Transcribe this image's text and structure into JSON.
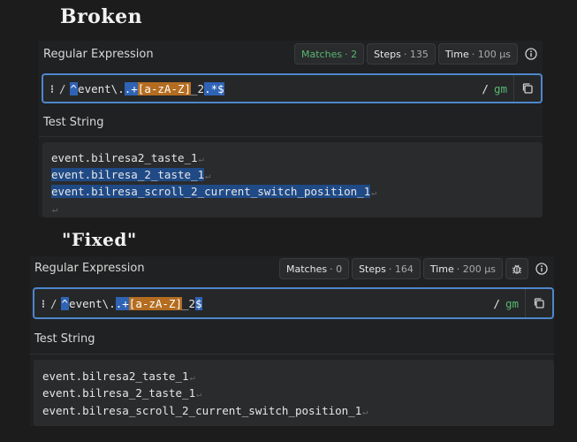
{
  "broken": {
    "heading": "Broken",
    "section_title": "Regular Expression",
    "stats": {
      "matches": "Matches",
      "matches_val": "· 2",
      "steps": "Steps",
      "steps_val": "· 135",
      "time": "Time",
      "time_val": "· 100 µs"
    },
    "regex": {
      "drag": "⁝",
      "open_slash": "/",
      "anchor": "^",
      "literal": "event\\.",
      "dot": ".",
      "plus": "+",
      "class": "[a-zA-Z]",
      "tail": "_2",
      "end": ".*$",
      "close_slash": "/",
      "flags": "gm"
    },
    "test_title": "Test String",
    "lines": [
      "event.bilresa2_taste_1",
      "event.bilresa_2_taste_1",
      "event.bilresa_scroll_2_current_switch_position_1",
      ""
    ],
    "newline_glyph": "↵"
  },
  "fixed": {
    "heading": "\"Fixed\"",
    "section_title": "Regular Expression",
    "stats": {
      "matches": "Matches",
      "matches_val": "· 0",
      "steps": "Steps",
      "steps_val": "· 164",
      "time": "Time",
      "time_val": "· 200 µs"
    },
    "regex": {
      "drag": "⁝",
      "open_slash": "/",
      "anchor": "^",
      "literal": "event\\.",
      "dot": ".",
      "plus": "+",
      "class": "[a-zA-Z]",
      "tail": "_2",
      "end": "$",
      "close_slash": "/",
      "flags": "gm"
    },
    "test_title": "Test String",
    "lines": [
      "event.bilresa2_taste_1",
      "event.bilresa_2_taste_1",
      "event.bilresa_scroll_2_current_switch_position_1"
    ],
    "newline_glyph": "↵"
  }
}
